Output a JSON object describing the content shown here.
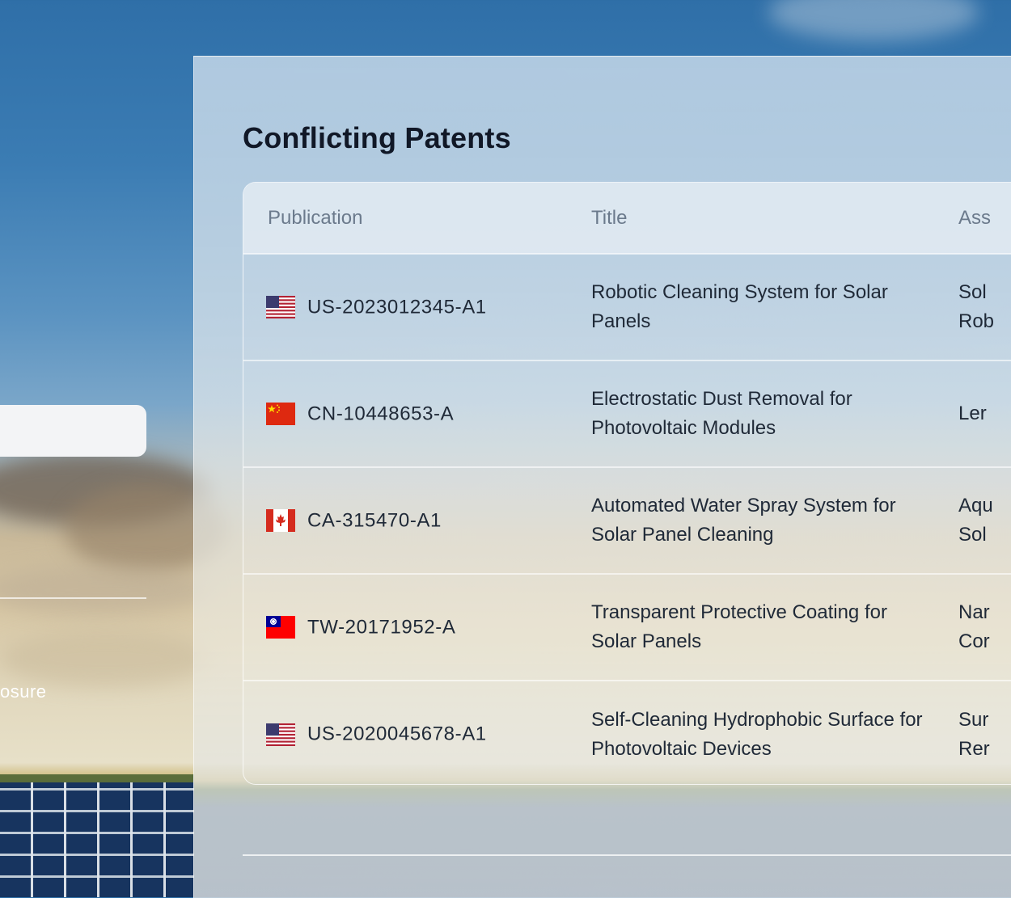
{
  "left": {
    "text_fragment": "osure"
  },
  "panel": {
    "title": "Conflicting Patents",
    "columns": {
      "publication": "Publication",
      "title": "Title",
      "assignee": "Ass"
    },
    "rows": [
      {
        "flag": "us-flag-icon",
        "publication": "US-2023012345-A1",
        "title": "Robotic Cleaning System for Solar Panels",
        "assignee_line1": "Sol",
        "assignee_line2": "Rob"
      },
      {
        "flag": "cn-flag-icon",
        "publication": "CN-10448653-A",
        "title": "Electrostatic Dust Removal for Photovoltaic Modules",
        "assignee_line1": "Ler",
        "assignee_line2": ""
      },
      {
        "flag": "ca-flag-icon",
        "publication": "CA-315470-A1",
        "title": "Automated Water Spray System for Solar Panel Cleaning",
        "assignee_line1": "Aqu",
        "assignee_line2": "Sol"
      },
      {
        "flag": "tw-flag-icon",
        "publication": "TW-20171952-A",
        "title": "Transparent Protective Coating for Solar Panels",
        "assignee_line1": "Nar",
        "assignee_line2": "Cor"
      },
      {
        "flag": "us-flag-icon",
        "publication": "US-2020045678-A1",
        "title": "Self-Cleaning Hydrophobic Surface for Photovoltaic Devices",
        "assignee_line1": "Sur",
        "assignee_line2": "Rer"
      }
    ]
  },
  "colors": {
    "title_text": "#111827",
    "header_text": "#6b7a8c",
    "body_text": "#1f2937"
  }
}
